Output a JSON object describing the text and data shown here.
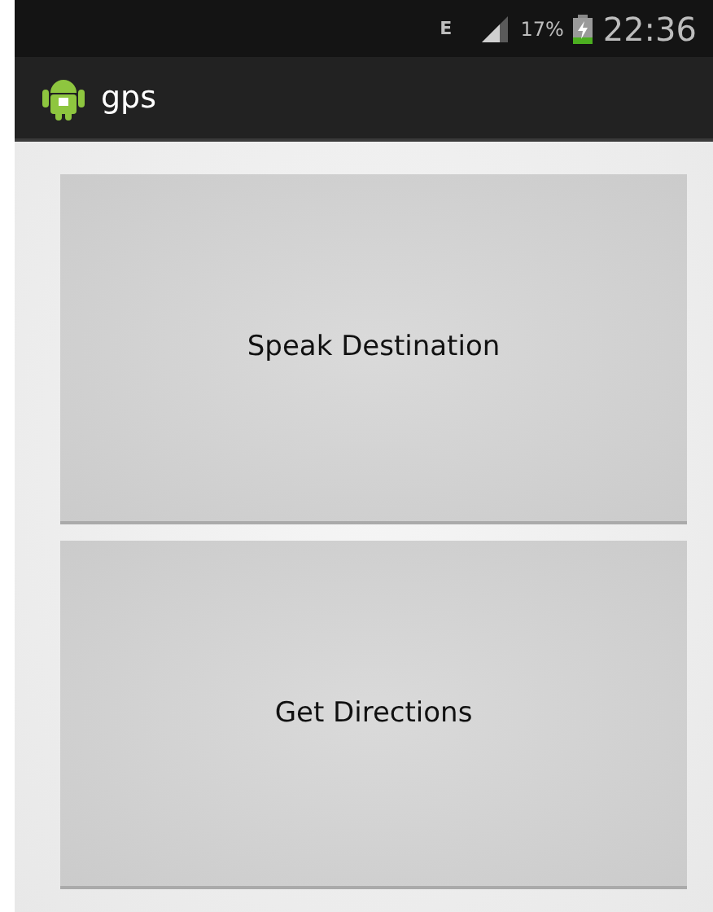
{
  "status_bar": {
    "network": "E",
    "battery_percent": "17%",
    "time": "22:36"
  },
  "action_bar": {
    "title": "gps"
  },
  "buttons": [
    {
      "label": "Speak Destination"
    },
    {
      "label": "Get Directions"
    }
  ]
}
